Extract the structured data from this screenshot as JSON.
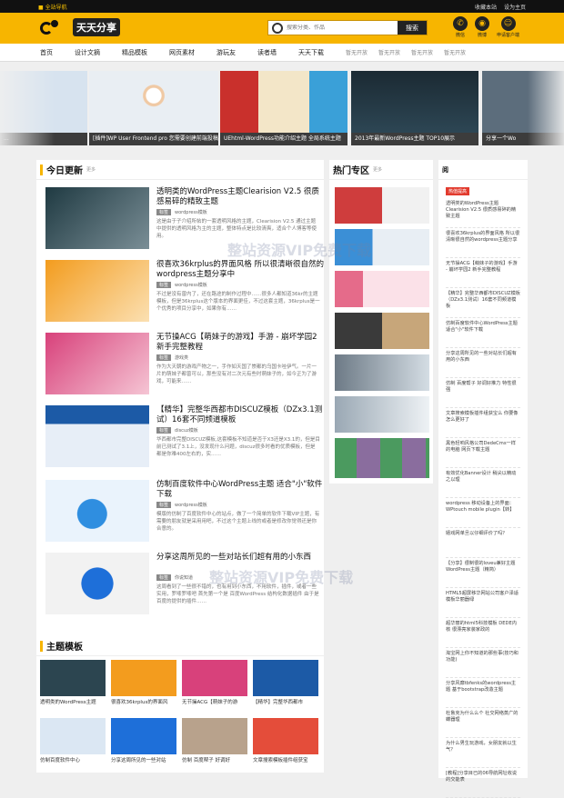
{
  "topbar": {
    "home": "■ 全站导航",
    "links": [
      "收藏本站",
      "设为主页"
    ]
  },
  "logo": {
    "text": "天天分享"
  },
  "search": {
    "placeholder": "搜索分类、作品",
    "button": "搜索"
  },
  "social": [
    {
      "icon": "wechat-icon",
      "glyph": "✆",
      "label": "微信"
    },
    {
      "icon": "weibo-icon",
      "glyph": "◉",
      "label": "微博"
    },
    {
      "icon": "qq-icon",
      "glyph": "☺",
      "label": "申请客户端"
    }
  ],
  "nav": [
    "首页",
    "设计文摘",
    "精品模板",
    "网页素材",
    "游玩友",
    "读者墙",
    "天天下载"
  ],
  "nav_dim": [
    "暂无开放",
    "暂无开放",
    "暂无开放",
    "暂无开放"
  ],
  "slides": [
    {
      "caption": "...",
      "color": "#d7e3ef"
    },
    {
      "caption": "[插件]WP User Frontend pro 您需要创建前端投稿插件",
      "color": "#e9eef3"
    },
    {
      "caption": "UEhtml-WordPress功能介绍主题 全局系统主题",
      "color": "#e2d7c8"
    },
    {
      "caption": "2013年最新WordPress主题 TOP10展示",
      "color": "#24343f"
    },
    {
      "caption": "分享一个Wo",
      "color": "#5c6d7c"
    }
  ],
  "latest": {
    "title": "今日更新",
    "more": "更多",
    "posts": [
      {
        "title": "透明类的WordPress主题Clearision V2.5 很质感易碎的精致主题",
        "tag": "标签",
        "cat": "wordpress模板",
        "excerpt": "这是由于子介绍所帖的一套透明风格的主题，Clearision V2.5 通过主题中提供的透明风格为主的主题，整体特点是比较清爽，适合个人博客等使用。",
        "color1": "#1f3a42",
        "color2": "#7a8e96"
      },
      {
        "title": "很喜欢36krplus的界面风格 所以很清晰很自然的wordpress主题分享中",
        "tag": "标签",
        "cat": "wordpress模板",
        "excerpt": "不过是没有曾内了，还在路途的制作过程中……很多人都知道36kr的主题模板，但是36krplus这个版本的界面更佳，不过这套主题，36krplus是一个优秀的项目分享中，如果你有……",
        "color1": "#f39c1e",
        "color2": "#fbe0b2"
      },
      {
        "title": "无节操ACG【萌妹子的游戏】手游 - 崩坏学园2 新手完整教程",
        "tag": "标签",
        "cat": "游戏类",
        "excerpt": "作为大天朝的游戏产物之一，手作如天国了崇都的乌国卡哇伊气。一片一片的萌妹子都曾可以，那些没有对二次元有些时萌妹子的，如今正为了游戏，可能来……",
        "color1": "#d8417b",
        "color2": "#f5c5d4"
      },
      {
        "title": "【精华】完整华西都市DISCUZ模板（DZx3.1测试）16套不同频道模板",
        "tag": "标签",
        "cat": "discuz模板",
        "excerpt": "华西都市完整DISCUZ模板,这套模板不知道是否于X3还是X3.1的，但是目前已测试了3.1上，没发现什么问题，discuz很多时看的优质模板，但是都是你难400左右的，实……",
        "color1": "#1c5aa6",
        "color2": "#e7eef7"
      },
      {
        "title": "仿制百度软件中心WordPress主题 适合\"小\"软件下载",
        "tag": "标签",
        "cat": "wordpress模板",
        "excerpt": "模版的仿制了百度软件中心的站点，做了一个简单的软件下载VIP主题，有需要的朋友就是采用用吧，不过这个主题上线的或者是修改你觉得还是你合意的。",
        "color1": "#2f8ee0",
        "color2": "#eaf3fc"
      },
      {
        "title": "分享这周所见的一些对站长们超有用的小东西",
        "tag": "标签",
        "cat": "你说知道",
        "excerpt": "这周看到了一些很不错的，也有用到小东西，不用软件，插件，或者一些实用，罗嗦罗嗦吧 首先第一个是 百度WordPress 结构化数据插件 由于是百度的提供的插件……",
        "color1": "#1e6fd9",
        "color2": "#f2f2f2"
      }
    ]
  },
  "topics": {
    "title": "主题模板",
    "more": "更多",
    "items": [
      {
        "caption": "透明类的WordPress主题",
        "color": "#2c4550"
      },
      {
        "caption": "很喜欢36krplus的界面风",
        "color": "#f39c1e"
      },
      {
        "caption": "无节操ACG【萌妹子的游",
        "color": "#d8417b"
      },
      {
        "caption": "【精华】完整华西都市",
        "color": "#1c5aa6"
      },
      {
        "caption": "仿制百度软件中心",
        "color": "#dbe7f3"
      },
      {
        "caption": "分享这周所见的一些对站",
        "color": "#1e6fd9"
      },
      {
        "caption": "仿制 百度帮子 好调好",
        "color": "#b8a28c"
      },
      {
        "caption": "文章搜索模板插件组获宝",
        "color": "#e44d3a"
      }
    ]
  },
  "hot": {
    "title": "热门专区",
    "more": "更多",
    "items": [
      {
        "color": "#cf3d3d"
      },
      {
        "color": "#3b8fd6"
      },
      {
        "color": "#e56b8a"
      },
      {
        "color": "#3a3a3a"
      },
      {
        "color": "#6d7a86"
      },
      {
        "color": "#9aa8b4"
      },
      {
        "color": "#4b9a5f"
      },
      {
        "color": "#8a6d9e"
      }
    ]
  },
  "newest": {
    "header": "阅",
    "badge": "热值提高",
    "items": [
      "透明类的WordPress主题 Clearision V2.5 很质感易碎的精致主题",
      "很喜欢36krplus的界面风格 所以很清晰很自然的wordpress主题分享",
      "无节操ACG【萌妹子的游戏】手游 - 崩坏学园2 新手完整教程",
      "【精华】完整华西都市DISCUZ模板（DZx3.1测试）16套不同频道模板",
      "仿制百度软件中心WordPress主题 适合\"小\"软件下载",
      "分享这周所见的一些对站长们超有用的小东西",
      "仿制 百度帮子 好调好推力 特性很强",
      "文章搜索模板插件组获宝么 你要像怎么更好了",
      "黑色轻响风格公司DedeCms一样的电脑 网页下载主题",
      "有效优化Banner设计 稍尖以精动之以理",
      "wordpress 移动设备上的界面：WPtouch mobile plugin【转】",
      "嬉戏网单旦以仔细评价了吗？",
      "【分享】很制很的loveu兼好主题WordPress主题（精简）",
      "HTML5超屏移华网站公司客户泽适模板华丽器绿",
      "超华丽的html5科技模板 DEDE内核 很漂亮家装家政的",
      "淘宝网上你不知道的那些事(技巧和功能)",
      "分享风靡tbfenks的wordpress主题 基于bootstrap改造主题",
      "杜鲁克为什么么个 社交网络蒸广的蝶器理",
      "为什么男生玩游戏，女朋友就以生气？",
      "[教程]分享目已的06导航网址收说的交能表"
    ]
  },
  "watermark": "整站资源VIP免费下载"
}
